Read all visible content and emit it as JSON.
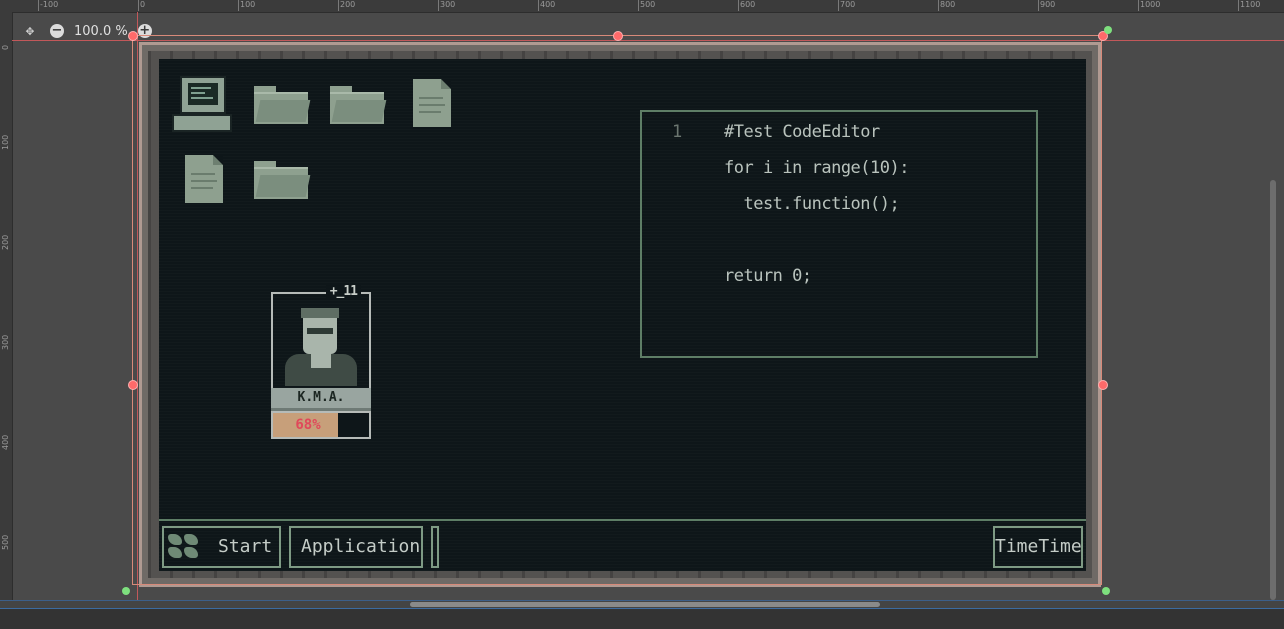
{
  "editor": {
    "zoom_label": "100.0 %",
    "zoom_out_icon": "minus-circle-icon",
    "zoom_in_icon": "plus-circle-icon",
    "fit_icon": "center-view-icon",
    "ruler_top": [
      "-100",
      "0",
      "100",
      "200",
      "300",
      "400",
      "500",
      "600",
      "700",
      "800",
      "900",
      "1000",
      "1100"
    ],
    "ruler_left": [
      "0",
      "100",
      "200",
      "300",
      "400",
      "500"
    ]
  },
  "desktop": {
    "icons": [
      "computer-icon",
      "folder-icon",
      "folder-icon",
      "document-icon",
      "document-icon",
      "folder-icon"
    ]
  },
  "code_editor": {
    "line_number": "1",
    "lines": [
      "#Test CodeEditor",
      "for i in range(10):",
      "  test.function();",
      "",
      "return 0;"
    ]
  },
  "profile": {
    "title": "+_11",
    "name": "K.M.A.",
    "progress_label": "68%",
    "progress_value": 0.68
  },
  "taskbar": {
    "start_label": "Start",
    "app_label": "Application",
    "time_label": "TimeTime"
  },
  "colors": {
    "screen_bg": "#0e1619",
    "panel_border": "#5e7e66",
    "progress_fill": "#c79f7a",
    "progress_text": "#e0485a",
    "guide": "#c2585a"
  }
}
